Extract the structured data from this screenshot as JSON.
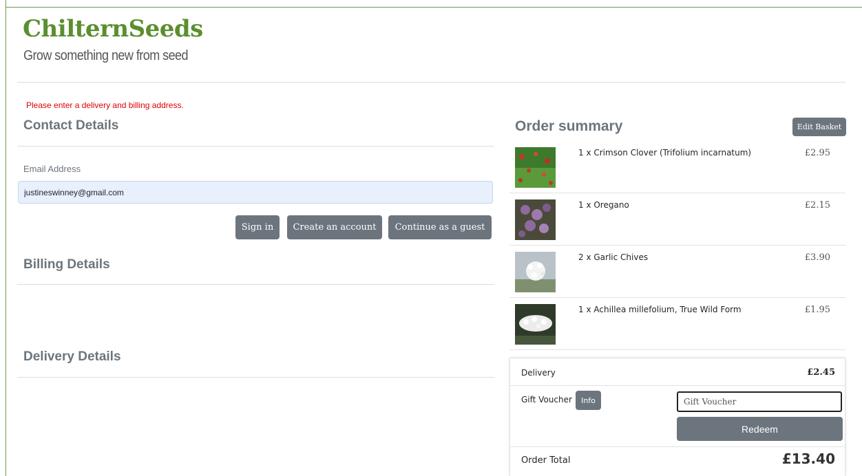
{
  "brand": {
    "logo": "ChilternSeeds",
    "tagline": "Grow something new from seed",
    "accent": "#5a8f2f"
  },
  "alert": {
    "text": "Please enter a delivery and billing address.",
    "color": "#e00000"
  },
  "contact": {
    "title": "Contact Details",
    "email_label": "Email Address",
    "email_value": "justineswinney@gmail.com",
    "buttons": {
      "sign_in": "Sign in",
      "create_account": "Create an account",
      "guest": "Continue as a guest"
    }
  },
  "billing": {
    "title": "Billing Details"
  },
  "delivery": {
    "title": "Delivery Details"
  },
  "summary": {
    "title": "Order summary",
    "edit_label": "Edit Basket",
    "items": [
      {
        "name": "1 x Crimson Clover (Trifolium incarnatum)",
        "price": "£2.95",
        "thumb": "crimson-clover"
      },
      {
        "name": "1 x Oregano",
        "price": "£2.15",
        "thumb": "oregano"
      },
      {
        "name": "2 x Garlic Chives",
        "price": "£3.90",
        "thumb": "garlic-chives"
      },
      {
        "name": "1 x Achillea millefolium, True Wild Form",
        "price": "£1.95",
        "thumb": "achillea"
      }
    ],
    "delivery_label": "Delivery",
    "delivery_value": "£2.45",
    "voucher_label": "Gift Voucher",
    "voucher_info": "Info",
    "voucher_placeholder": "Gift Voucher",
    "redeem_label": "Redeem",
    "total_label": "Order Total",
    "total_value": "£13.40"
  }
}
